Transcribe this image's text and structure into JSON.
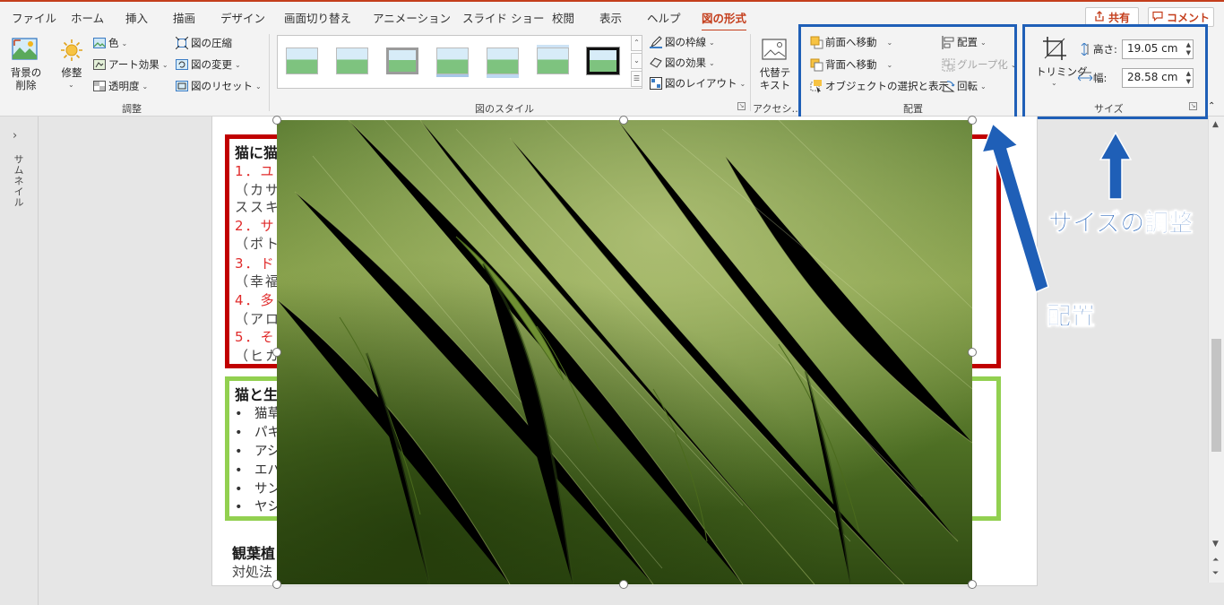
{
  "tabs": [
    "ファイル",
    "ホーム",
    "挿入",
    "描画",
    "デザイン",
    "画面切り替え",
    "アニメーション",
    "スライド ショー",
    "校閲",
    "表示",
    "ヘルプ",
    "図の形式"
  ],
  "active_tab": "図の形式",
  "share_label": "共有",
  "comment_label": "コメント",
  "ribbon": {
    "remove_bg": "背景の\n削除",
    "corrections": "修整",
    "color": "色",
    "artistic": "アート効果",
    "transparency": "透明度",
    "compress": "図の圧縮",
    "change": "図の変更",
    "reset": "図のリセット",
    "adjust_group": "調整",
    "border": "図の枠線",
    "effects": "図の効果",
    "layout": "図のレイアウト",
    "styles_group": "図のスタイル",
    "alt_text": "代替テ\nキスト",
    "accessibility_group": "アクセシ…",
    "bring_forward": "前面へ移動",
    "send_backward": "背面へ移動",
    "selection_pane": "オブジェクトの選択と表示",
    "align": "配置",
    "group": "グループ化",
    "rotate": "回転",
    "arrange_group": "配置",
    "crop": "トリミング",
    "height_label": "高さ:",
    "height_value": "19.05 cm",
    "width_label": "幅:",
    "width_value": "28.58 cm",
    "size_group": "サイズ"
  },
  "thumbnail_pane_label": "サムネイル",
  "slide": {
    "heading1": "猫に猫",
    "items": [
      {
        "num": "1．ユ",
        "sub": "（カサ"
      },
      {
        "num": "",
        "sub": "ススキ"
      },
      {
        "num": "2．サ",
        "sub": "（ポト"
      },
      {
        "num": "3．ド",
        "sub": "（幸福"
      },
      {
        "num": "4．多",
        "sub": "（アロ"
      },
      {
        "num": "5．そ",
        "sub": "（ヒカ"
      }
    ],
    "heading2": "猫と生",
    "bullets": [
      "猫草",
      "パキ",
      "アシ",
      "エバ",
      "サン",
      "ヤシ"
    ],
    "heading3": "観葉植",
    "footer_text": "対処法"
  },
  "annotations": {
    "size": "サイズの調整",
    "arrange": "配置"
  },
  "colors": {
    "accent": "#c43e1c",
    "highlight": "#1f5fb7",
    "red_box": "#c00000",
    "green_box": "#92d050"
  }
}
